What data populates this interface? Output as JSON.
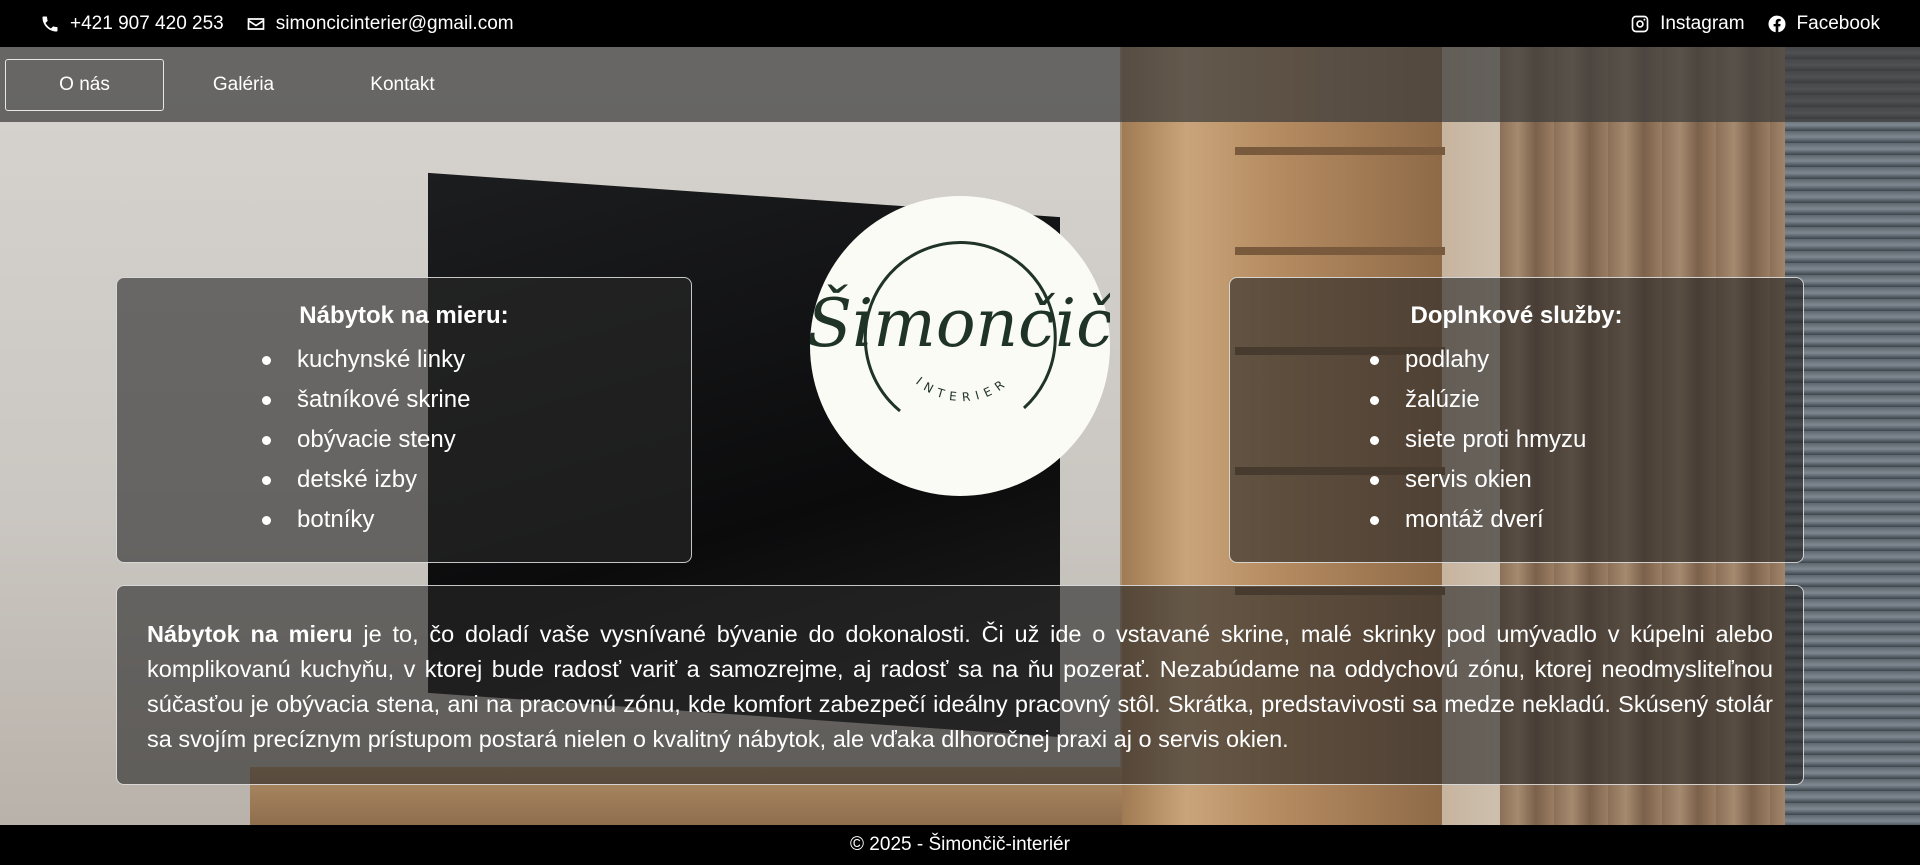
{
  "topbar": {
    "phone": "+421 907 420 253",
    "email": "simoncicinterier@gmail.com",
    "instagram": "Instagram",
    "facebook": "Facebook"
  },
  "nav": {
    "items": [
      {
        "label": "O nás",
        "active": true
      },
      {
        "label": "Galéria",
        "active": false
      },
      {
        "label": "Kontakt",
        "active": false
      }
    ]
  },
  "logo": {
    "name": "Šimončič",
    "subtitle": "INTERIER"
  },
  "furniture": {
    "title": "Nábytok na mieru:",
    "items": [
      "kuchynské linky",
      "šatníkové skrine",
      "obývacie steny",
      "detské izby",
      "botníky"
    ]
  },
  "services": {
    "title": "Doplnkové služby:",
    "items": [
      "podlahy",
      "žalúzie",
      "siete proti hmyzu",
      "servis okien",
      "montáž dverí"
    ]
  },
  "about": {
    "lead": "Nábytok na mieru",
    "text": " je to, čo doladí vaše vysnívané bývanie do dokonalosti. Či už ide o vstavané skrine, malé skrinky pod umývadlo v kúpelni alebo komplikovanú kuchyňu, v ktorej bude radosť variť a samozrejme, aj radosť sa na ňu pozerať. Nezabúdame na oddychovú zónu, ktorej neodmysliteľnou súčasťou je obývacia stena, ani na pracovnú zónu, kde komfort zabezpečí ideálny pracovný stôl. Skrátka, predstavivosti sa medze nekladú. Skúsený stolár sa svojím precíznym prístupom postará nielen o kvalitný nábytok, ale vďaka dlhoročnej praxi aj o servis okien."
  },
  "footer": {
    "text": "© 2025 - Šimončič-interiér"
  },
  "icons": [
    "phone-icon",
    "mail-icon",
    "instagram-icon",
    "facebook-icon"
  ],
  "colors": {
    "bar": "#000000",
    "logo_bg": "#fbfbf6",
    "logo_ink": "#1f3326"
  }
}
